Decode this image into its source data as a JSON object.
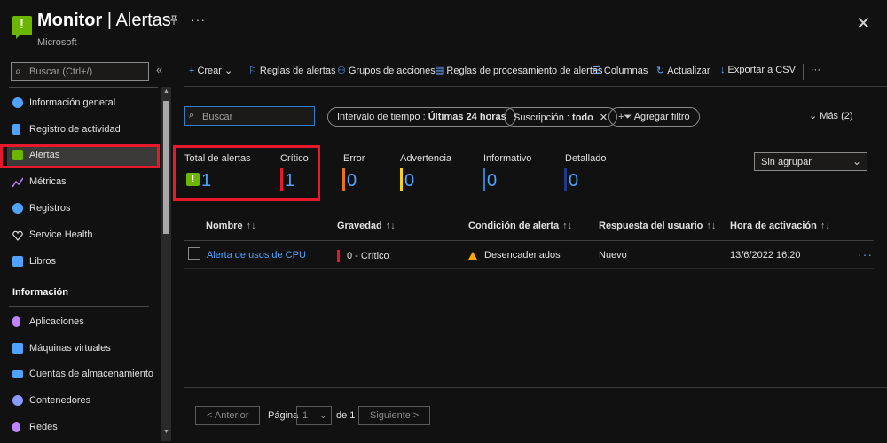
{
  "header": {
    "title_main": "Monitor",
    "title_sep": " | ",
    "title_page": "Alertas",
    "subtitle": "Microsoft",
    "more": "···",
    "close": "✕"
  },
  "sidebar": {
    "search_placeholder": "Buscar (Ctrl+/)",
    "collapse": "«",
    "items": [
      {
        "label": "Información general",
        "icon": "gauge-icon",
        "color": "#4fa3ff"
      },
      {
        "label": "Registro de actividad",
        "icon": "log-icon",
        "color": "#4fa3ff"
      },
      {
        "label": "Alertas",
        "icon": "alert-icon",
        "color": "#6bb700"
      },
      {
        "label": "Métricas",
        "icon": "metrics-icon",
        "color": "#c084fc"
      },
      {
        "label": "Registros",
        "icon": "logs-icon",
        "color": "#4fa3ff"
      },
      {
        "label": "Service Health",
        "icon": "heart-icon",
        "color": "#e0e0e0"
      },
      {
        "label": "Libros",
        "icon": "workbook-icon",
        "color": "#4fa3ff"
      }
    ],
    "section_title": "Información",
    "section_items": [
      {
        "label": "Aplicaciones",
        "icon": "bulb-icon",
        "color": "#c084fc"
      },
      {
        "label": "Máquinas virtuales",
        "icon": "vm-icon",
        "color": "#4fa3ff"
      },
      {
        "label": "Cuentas de almacenamiento",
        "icon": "storage-icon",
        "color": "#4fa3ff"
      },
      {
        "label": "Contenedores",
        "icon": "containers-icon",
        "color": "#8a9cff"
      },
      {
        "label": "Redes",
        "icon": "network-icon",
        "color": "#c084fc"
      }
    ]
  },
  "toolbar": {
    "crear": "Crear",
    "reglas_alertas": "Reglas de alertas",
    "grupos_acciones": "Grupos de acciones",
    "reglas_procesamiento": "Reglas de procesamiento de alertas",
    "columnas": "Columnas",
    "actualizar": "Actualizar",
    "exportar": "Exportar a CSV",
    "more": "···"
  },
  "filters": {
    "search_placeholder": "Buscar",
    "time_label": "Intervalo de tiempo : ",
    "time_value": "Últimas 24 horas",
    "sub_label": "Suscripción : ",
    "sub_value": "todo",
    "add_filter": "Agregar filtro",
    "more": "Más (2)"
  },
  "summary": {
    "total_label": "Total de alertas",
    "total_value": "1",
    "critico_label": "Crítico",
    "critico_value": "1",
    "error_label": "Error",
    "error_value": "0",
    "advertencia_label": "Advertencia",
    "advertencia_value": "0",
    "informativo_label": "Informativo",
    "informativo_value": "0",
    "detallado_label": "Detallado",
    "detallado_value": "0",
    "colors": {
      "critico": "#e8192c",
      "error": "#e8731a",
      "advertencia": "#f8d21a",
      "informativo": "#2f7fd0",
      "detallado": "#1e3a8a"
    }
  },
  "groupby": {
    "value": "Sin agrupar"
  },
  "table": {
    "headers": [
      "Nombre",
      "Gravedad",
      "Condición de alerta",
      "Respuesta del usuario",
      "Hora de activación"
    ],
    "rows": [
      {
        "nombre": "Alerta de usos de CPU",
        "gravedad": "0 - Crítico",
        "condicion": "Desencadenados",
        "respuesta": "Nuevo",
        "hora": "13/6/2022 16:20"
      }
    ],
    "row_more": "···"
  },
  "pager": {
    "prev": "< Anterior",
    "page_label": "Página",
    "page_value": "1",
    "of_label": "de 1",
    "next": "Siguiente >"
  }
}
